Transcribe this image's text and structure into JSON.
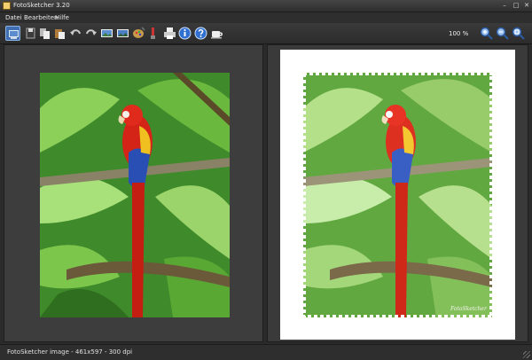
{
  "window": {
    "title": "FotoSketcher 3.20"
  },
  "menu": {
    "items": [
      "Datei",
      "Bearbeiten",
      "Hilfe"
    ]
  },
  "toolbar": {
    "zoom": "100 %"
  },
  "status": {
    "text": "FotoSketcher image - 461x597 - 300 dpi"
  },
  "artwork": {
    "signature": "FotoSketcher"
  }
}
